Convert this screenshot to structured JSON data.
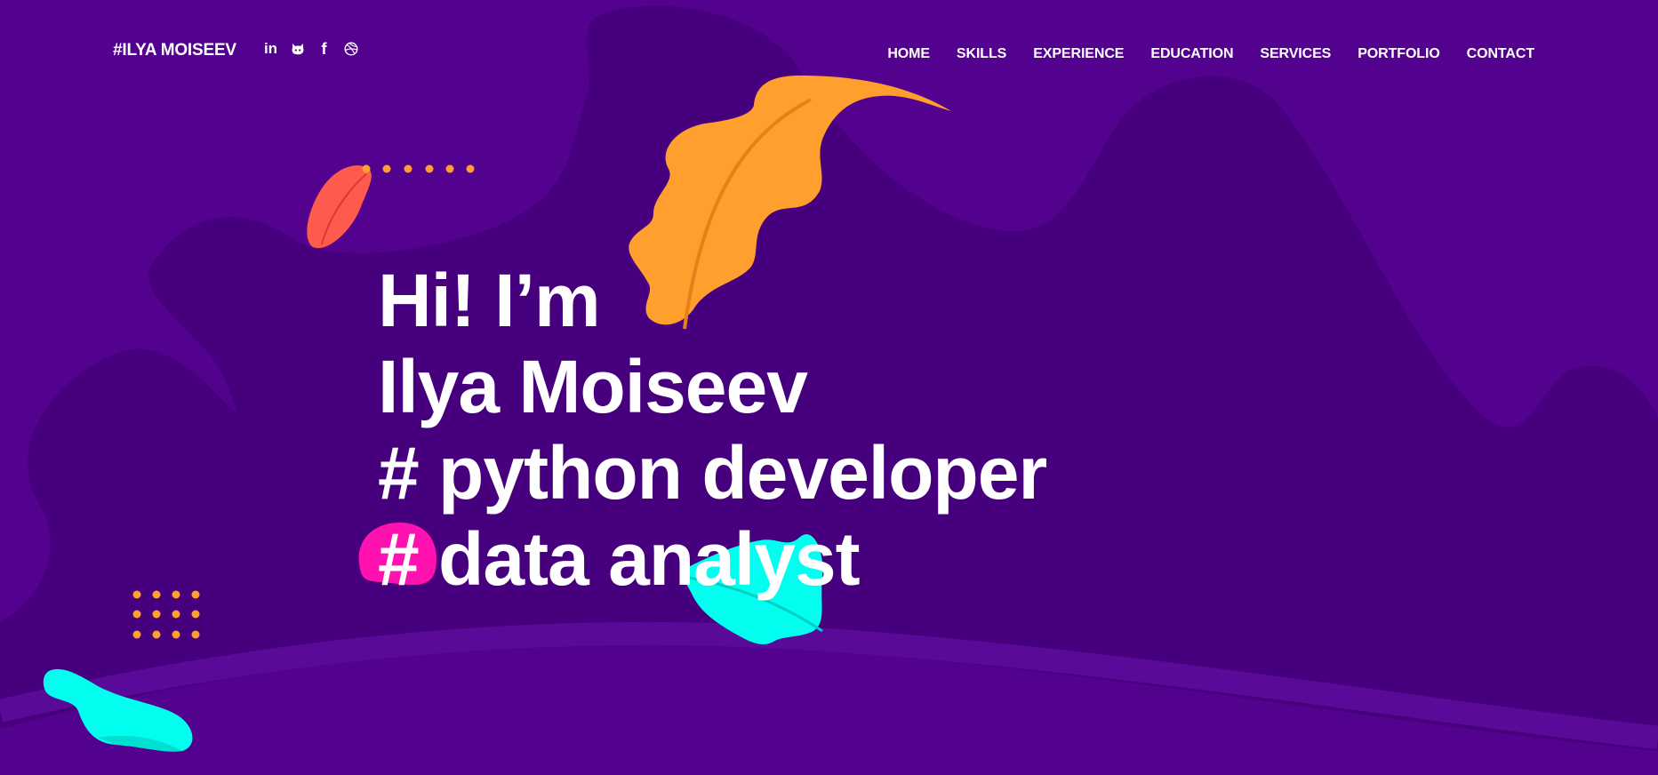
{
  "header": {
    "logo": "#ILYA MOISEEV"
  },
  "social": [
    {
      "icon": "linkedin-icon",
      "label": "in"
    },
    {
      "icon": "github-icon"
    },
    {
      "icon": "facebook-icon",
      "label": "f"
    },
    {
      "icon": "dribbble-icon"
    }
  ],
  "nav": [
    {
      "label": "HOME"
    },
    {
      "label": "SKILLS"
    },
    {
      "label": "EXPERIENCE"
    },
    {
      "label": "EDUCATION"
    },
    {
      "label": "SERVICES"
    },
    {
      "label": "PORTFOLIO"
    },
    {
      "label": "CONTACT"
    }
  ],
  "hero": {
    "line1": "Hi! I’m",
    "line2": "Ilya Moiseev",
    "line3": "# python developer",
    "line4": "# data analyst"
  },
  "colors": {
    "background": "#52028e",
    "blob_dark": "#46007e",
    "orange_leaf": "#ff9f2e",
    "coral_leaf": "#ff5a4e",
    "cyan_leaf": "#00ffee",
    "pink_blob": "#ff12b0",
    "dots": "#ff9f2e",
    "text": "#ffffff"
  }
}
